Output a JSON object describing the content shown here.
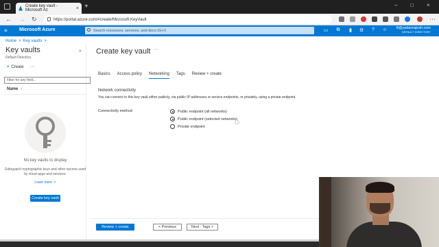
{
  "browser": {
    "tab_title": "Create key vault - Microsoft Az",
    "tab_close": "×",
    "new_tab": "+",
    "url": "https://portal.azure.com/#create/Microsoft.KeyVault",
    "window_controls": [
      "–",
      "□",
      "×"
    ]
  },
  "azure_header": {
    "brand": "Microsoft Azure",
    "search_placeholder": "Search resources, services, and docs (G+/)",
    "user_name": "ft@yadavrajesh.com",
    "user_directory": "DEFAULT DIRECTORY"
  },
  "breadcrumb": [
    "Home",
    "Key vaults"
  ],
  "left_panel": {
    "title": "Key vaults",
    "subtitle": "Default Directory",
    "create_label": "Create",
    "more": "···",
    "filter_placeholder": "Filter for any field...",
    "column_header": "Name",
    "sort_indicator": "↑",
    "empty_title": "No key vaults to display",
    "empty_description": "Safeguard cryptographic keys and other secrets used by cloud apps and services.",
    "learn_more": "Learn more ↗",
    "create_button": "Create key vault"
  },
  "blade": {
    "title": "Create key vault",
    "more": "···",
    "tabs": [
      {
        "label": "Basics",
        "active": false
      },
      {
        "label": "Access policy",
        "active": false
      },
      {
        "label": "Networking",
        "active": true
      },
      {
        "label": "Tags",
        "active": false
      },
      {
        "label": "Review + create",
        "active": false
      }
    ],
    "section_title": "Network connectivity",
    "section_description": "You can connect to this key vault either publicly, via public IP addresses or service endpoints, or privately, using a private endpoint.",
    "connectivity_label": "Connectivity method",
    "options": [
      {
        "label": "Public endpoint (all networks)",
        "selected": true
      },
      {
        "label": "Public endpoint (selected networks)",
        "selected": true
      },
      {
        "label": "Private endpoint",
        "selected": false
      }
    ],
    "footer": {
      "review_create": "Review + create",
      "previous": "< Previous",
      "next": "Next : Tags >"
    }
  },
  "colors": {
    "accent": "#0078d4",
    "header_bg": "#0078d4",
    "text": "#323130"
  }
}
